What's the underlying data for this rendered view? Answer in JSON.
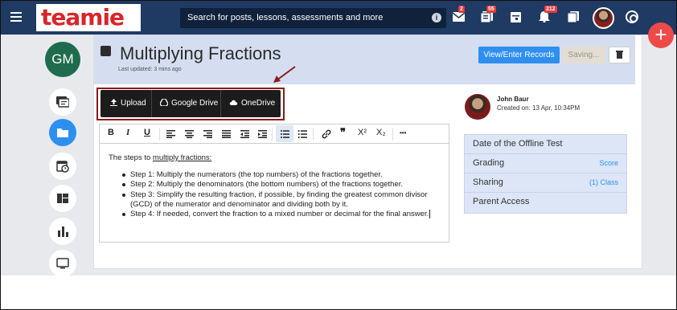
{
  "app": {
    "logo_text": "teamie",
    "search_placeholder": "Search for posts, lessons, assessments and more",
    "badges": {
      "messages": "2",
      "updates": "55",
      "notifications": "212"
    },
    "user_initials": "GM"
  },
  "page": {
    "title": "Multiplying Fractions",
    "last_updated": "Last updated: 3 mins ago",
    "view_button": "View/Enter Records",
    "saving_label": "Saving..."
  },
  "upload": {
    "upload_label": "Upload",
    "gdrive_label": "Google Drive",
    "onedrive_label": "OneDrive"
  },
  "editor": {
    "toolbar": {
      "bold": "B",
      "italic": "I",
      "underline": "U",
      "quote": "❞",
      "superscript": "X²",
      "subscript": "X₂",
      "more": "•••"
    },
    "intro_prefix": "The steps to ",
    "intro_link": "multiply fractions:",
    "steps": [
      {
        "label": "Step 1:",
        "text": " Multiply the numerators (the top numbers) of the fractions together."
      },
      {
        "label": "Step 2:",
        "text": " Multiply the denominators (the bottom numbers) of the fractions together."
      },
      {
        "label": "Step 3:",
        "text": " Simplify the resulting fraction, if possible, by finding the greatest common divisor (GCD) of the numerator and denominator and dividing both by it."
      },
      {
        "label": "Step 4:",
        "text": " If needed, convert the fraction to a mixed number or decimal for the final answer."
      }
    ]
  },
  "author": {
    "name": "John Baur",
    "created": "Created on: 13 Apr, 10:34PM"
  },
  "panel": {
    "rows": [
      {
        "label": "Date of the Offline Test",
        "value": ""
      },
      {
        "label": "Grading",
        "value": "Score"
      },
      {
        "label": "Sharing",
        "value": "(1) Class"
      },
      {
        "label": "Parent Access",
        "value": ""
      }
    ]
  },
  "colors": {
    "topbar": "#1f3a63",
    "accent": "#2e8ff0",
    "fab": "#ef4a4a",
    "highlight_box": "#8b1a1a"
  }
}
